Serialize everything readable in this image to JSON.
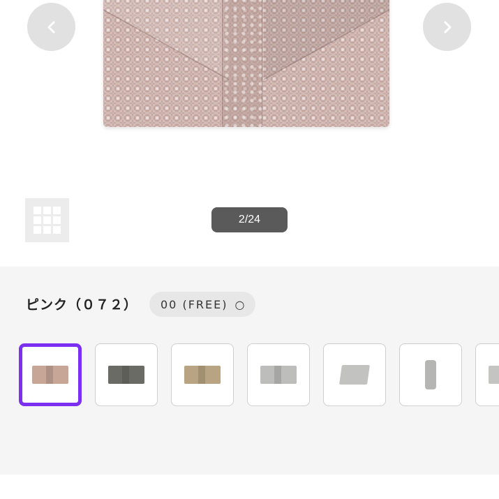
{
  "gallery": {
    "counter": "2/24",
    "prev_icon": "chevron-left-icon",
    "next_icon": "chevron-right-icon",
    "grid_icon": "grid-icon"
  },
  "options": {
    "color_name": "ピンク（０７２）",
    "size_label": "00 (FREE)",
    "stock_symbol": "○"
  },
  "thumbnails": [
    {
      "label": "pink",
      "color": "#c7a597",
      "shape": "wallet",
      "selected": true
    },
    {
      "label": "dark gray",
      "color": "#6b6b66",
      "shape": "wallet",
      "selected": false
    },
    {
      "label": "beige",
      "color": "#b8a382",
      "shape": "wallet",
      "selected": false
    },
    {
      "label": "light gray",
      "color": "#bdbdbb",
      "shape": "wallet",
      "selected": false
    },
    {
      "label": "light gray angled",
      "color": "#c2c2c0",
      "shape": "tilt",
      "selected": false
    },
    {
      "label": "light gray side",
      "color": "#b5b5b3",
      "shape": "side",
      "selected": false
    },
    {
      "label": "partial",
      "color": "#c4c4c2",
      "shape": "wallet",
      "selected": false
    }
  ],
  "colors": {
    "accent": "#7b2ff0",
    "counter_bg": "#5a5a5a",
    "options_bg": "#f5f5f5"
  }
}
